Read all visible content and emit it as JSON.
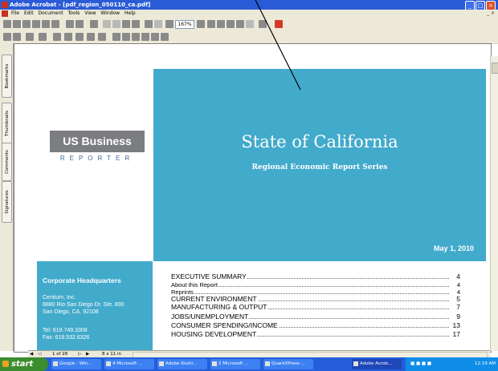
{
  "window": {
    "title": "Adobe Acrobat - [pdf_region_050110_ca.pdf]",
    "controls": [
      "_",
      "□",
      "×"
    ],
    "doc_controls": "_ ×"
  },
  "menu": {
    "items": [
      "File",
      "Edit",
      "Document",
      "Tools",
      "View",
      "Window",
      "Help"
    ]
  },
  "toolbar": {
    "zoom": "167%"
  },
  "side_tabs": [
    "Bookmarks",
    "Thumbnails",
    "Comments",
    "Signatures"
  ],
  "document": {
    "cover_title": "State of California",
    "cover_subtitle": "Regional Economic Report Series",
    "date": "May 1, 2010",
    "logo_top": "US Business",
    "logo_bottom": "REPORTER",
    "hq": {
      "title": "Corporate Headquarters",
      "lines": [
        "Centium, Inc.",
        "8880 Rio San Diego Dr. Ste. 800",
        "San Diego, CA. 92108",
        "",
        "Tel: 619.749.3308",
        "Fax: 619.532.6326"
      ]
    },
    "toc": [
      {
        "label": "EXECUTIVE SUMMARY",
        "page": "4",
        "big": true
      },
      {
        "label": "About this Report",
        "page": "4",
        "big": false
      },
      {
        "label": "Reprints",
        "page": "4",
        "big": false
      },
      {
        "label": "CURRENT ENVIRONMENT",
        "page": "5",
        "big": true
      },
      {
        "label": "MANUFACTURING & OUTPUT",
        "page": "7",
        "big": true
      },
      {
        "label": "JOBS/UNEMPLOYMENT",
        "page": "9",
        "big": true
      },
      {
        "label": "CONSUMER SPENDING/INCOME",
        "page": "13",
        "big": true
      },
      {
        "label": "HOUSING DEVELOPMENT",
        "page": "17",
        "big": true
      }
    ]
  },
  "navbar": {
    "page_counter": "1 of 28",
    "page_size": "8 x 11 in"
  },
  "taskbar": {
    "start": "start",
    "tasks": [
      {
        "label": "Google - Win...",
        "active": false
      },
      {
        "label": "4 Microsoft ...",
        "active": false
      },
      {
        "label": "Adobe Illustr...",
        "active": false
      },
      {
        "label": "2 Microsoft ...",
        "active": false
      },
      {
        "label": "QuarkXPress ...",
        "active": false
      },
      {
        "label": "Adobe Acrob...",
        "active": true
      }
    ],
    "clock": "12:19 AM"
  }
}
